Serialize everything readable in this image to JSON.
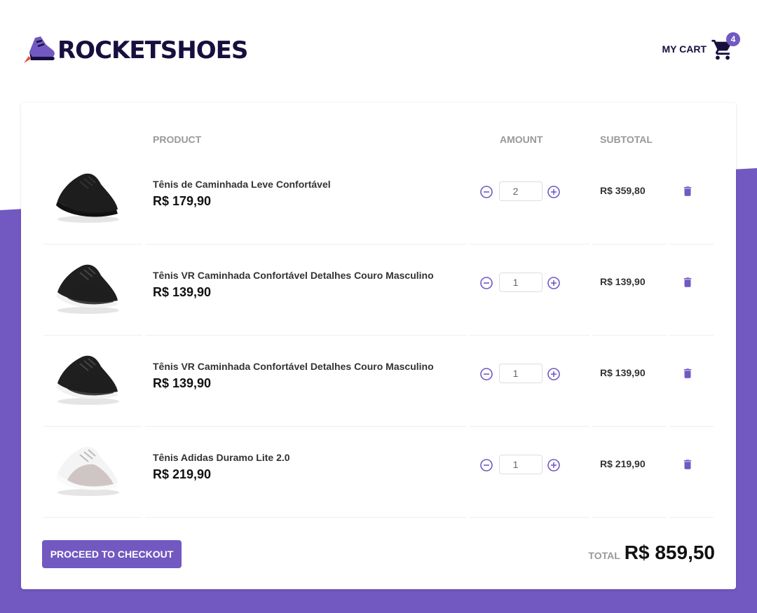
{
  "brand": {
    "name": "ROCKETSHOES"
  },
  "cart_link": {
    "label": "MY CART",
    "count": "4"
  },
  "table": {
    "headers": {
      "product": "PRODUCT",
      "amount": "AMOUNT",
      "subtotal": "SUBTOTAL"
    },
    "items": [
      {
        "name": "Tênis de Caminhada Leve Confortável",
        "price": "R$ 179,90",
        "amount": "2",
        "subtotal": "R$ 359,80",
        "shoe_color": "black"
      },
      {
        "name": "Tênis VR Caminhada Confortável Detalhes Couro Masculino",
        "price": "R$ 139,90",
        "amount": "1",
        "subtotal": "R$ 139,90",
        "shoe_color": "black-white"
      },
      {
        "name": "Tênis VR Caminhada Confortável Detalhes Couro Masculino",
        "price": "R$ 139,90",
        "amount": "1",
        "subtotal": "R$ 139,90",
        "shoe_color": "black-white"
      },
      {
        "name": "Tênis Adidas Duramo Lite 2.0",
        "price": "R$ 219,90",
        "amount": "1",
        "subtotal": "R$ 219,90",
        "shoe_color": "white"
      }
    ]
  },
  "footer": {
    "checkout_label": "PROCEED TO CHECKOUT",
    "total_label": "TOTAL",
    "total_value": "R$ 859,50"
  },
  "colors": {
    "accent": "#7159c1",
    "brand_text": "#170f3e",
    "background_band": "#7159c1"
  },
  "icons": {
    "logo": "rocket-sneaker-icon",
    "cart": "cart-icon",
    "minus": "remove-circle-icon",
    "plus": "add-circle-icon",
    "delete": "trash-icon"
  }
}
